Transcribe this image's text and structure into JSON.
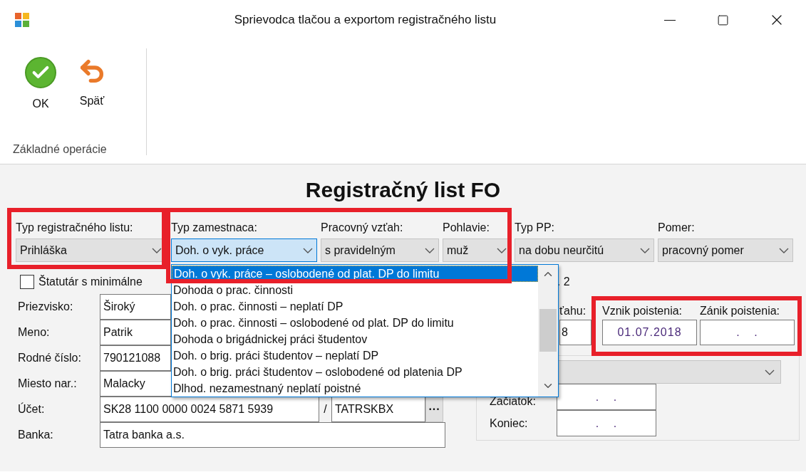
{
  "window": {
    "title": "Sprievodca tlačou a exportom registračného listu"
  },
  "ribbon": {
    "buttons": [
      {
        "kind": "ok",
        "label": "OK"
      },
      {
        "kind": "back",
        "label": "Späť"
      }
    ],
    "group_label": "Základné operácie"
  },
  "heading": "Registračný list FO",
  "combos": [
    {
      "label": "Typ registračného listu:",
      "value": "Prihláška",
      "focused": false
    },
    {
      "label": "Typ zamestnaca:",
      "value": "Doh. o vyk. práce",
      "focused": true
    },
    {
      "label": "Pracovný vzťah:",
      "value": "s pravidelným",
      "focused": false
    },
    {
      "label": "Pohlavie:",
      "value": "muž",
      "focused": false
    },
    {
      "label": "Typ PP:",
      "value": "na dobu neurčitú",
      "focused": false
    },
    {
      "label": "Pomer:",
      "value": "pracovný pomer",
      "focused": false
    }
  ],
  "dropdown": {
    "items": [
      {
        "label": "Doh. o vyk. práce – oslobodené od plat. DP do limitu",
        "selected": true
      },
      {
        "label": "Dohoda o prac. činnosti",
        "selected": false
      },
      {
        "label": "Doh. o prac. činnosti – neplatí DP",
        "selected": false
      },
      {
        "label": "Doh. o prac. činnosti – oslobodené od plat. DP do limitu",
        "selected": false
      },
      {
        "label": "Dohoda o brigádnickej práci študentov",
        "selected": false
      },
      {
        "label": "Doh. o brig. práci študentov – neplatí DP",
        "selected": false
      },
      {
        "label": "Doh. o brig. práci študentov – oslobodené od platenia DP",
        "selected": false
      },
      {
        "label": "Dlhod. nezamestnaný neplatí poistné",
        "selected": false
      }
    ]
  },
  "checkbox": {
    "label": "Štatutár s minimálne",
    "checked": false
  },
  "fragment": ". 2",
  "person": {
    "fields": [
      {
        "label": "Priezvisko:",
        "value": "Široký"
      },
      {
        "label": "Meno:",
        "value": "Patrik"
      },
      {
        "label": "Rodné číslo:",
        "value": "790121088"
      },
      {
        "label": "Miesto nar.:",
        "value": "Malacky"
      }
    ],
    "account": {
      "label": "Účet:",
      "iban": "SK28 1100 0000 0024 5871 5939",
      "separator": "/",
      "bic": "TATRSKBX",
      "browse": "···"
    },
    "bank": {
      "label": "Banka:",
      "value": "Tatra banka a.s."
    }
  },
  "relation": {
    "label": "ťahu:",
    "value": "8"
  },
  "insurance": [
    {
      "label": "Vznik poistenia:",
      "value": "01.07.2018"
    },
    {
      "label": "Zánik poistenia:",
      "value": ". ."
    }
  ],
  "period": [
    {
      "label": "Začiatok:",
      "value": ". ."
    },
    {
      "label": "Koniec:",
      "value": ". ."
    }
  ]
}
